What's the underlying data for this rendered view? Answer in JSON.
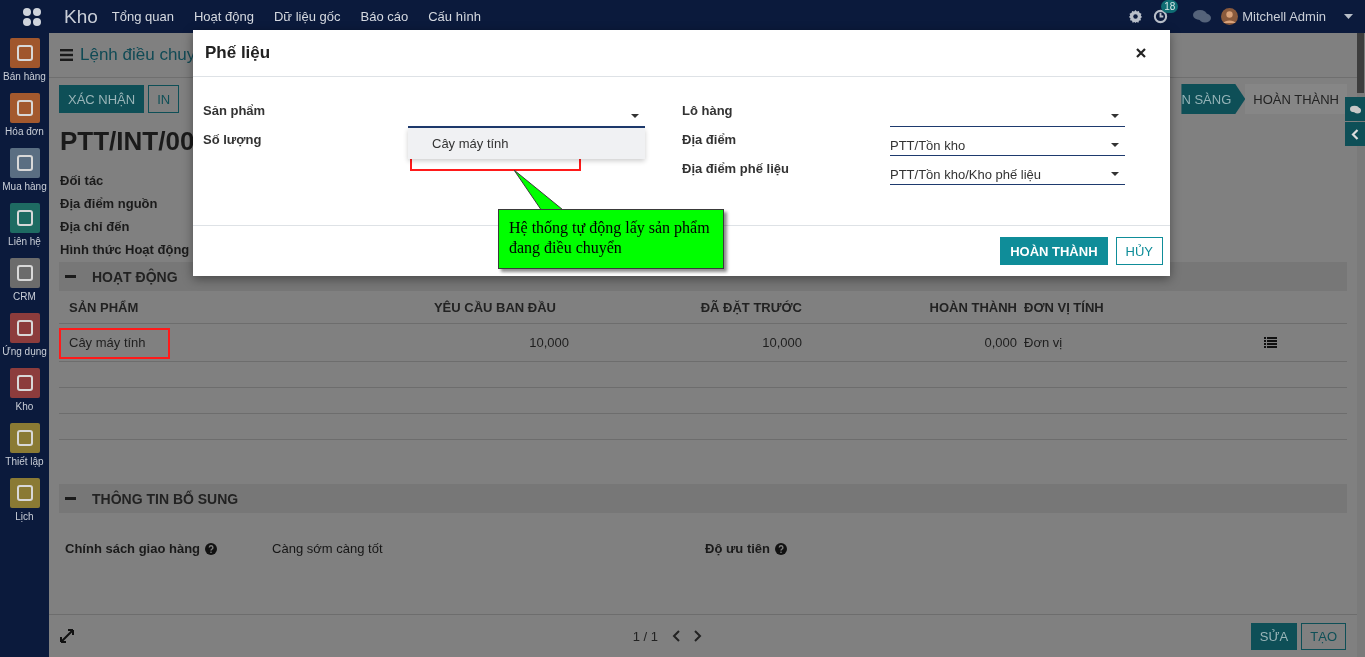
{
  "top_bar": {
    "app_name": "Kho",
    "menu": [
      "Tổng quan",
      "Hoạt động",
      "Dữ liệu gốc",
      "Báo cáo",
      "Cấu hình"
    ],
    "notification_count": "18",
    "user_name": "Mitchell Admin"
  },
  "sidebar": {
    "items": [
      {
        "label": "Bán hàng",
        "color": "#a0562c"
      },
      {
        "label": "Hóa đơn",
        "color": "#a3592e"
      },
      {
        "label": "Mua hàng",
        "color": "#5a6e82"
      },
      {
        "label": "Liên hệ",
        "color": "#1e6b62"
      },
      {
        "label": "CRM",
        "color": "#6b6b6b"
      },
      {
        "label": "Ứng dụng",
        "color": "#8c3c3c"
      },
      {
        "label": "Kho",
        "color": "#8c3c3c"
      },
      {
        "label": "Thiết lập",
        "color": "#8a7a34"
      },
      {
        "label": "Lịch",
        "color": "#8a7a34"
      }
    ]
  },
  "breadcrumb": "Lệnh điều chuy",
  "action_buttons": [
    {
      "label": "XÁC NHẬN",
      "kind": "primary"
    },
    {
      "label": "IN",
      "kind": "secondary"
    }
  ],
  "status_steps": [
    {
      "label": "N SÀNG",
      "selected": true
    },
    {
      "label": "HOÀN THÀNH",
      "selected": false
    }
  ],
  "record_title": "PTT/INT/00",
  "form_labels": [
    "Đối tác",
    "Địa điểm nguồn",
    "Địa chỉ đến",
    "Hình thức Hoạt động"
  ],
  "operations": {
    "title": "HOẠT ĐỘNG",
    "columns": [
      "SẢN PHẨM",
      "YÊU CẦU BAN ĐẦU",
      "ĐÃ ĐẶT TRƯỚC",
      "HOÀN THÀNH",
      "ĐƠN VỊ TÍNH"
    ],
    "rows": [
      {
        "cells": [
          "Cây máy tính",
          "10,000",
          "10,000",
          "0,000",
          "Đơn vị"
        ],
        "highlighted": true
      }
    ]
  },
  "extra_info": {
    "title": "THÔNG TIN BỔ SUNG",
    "fields": [
      {
        "label": "Chính sách giao hàng",
        "value": "Càng sớm càng tốt"
      },
      {
        "label": "Độ ưu tiên"
      }
    ]
  },
  "pager": "1 / 1",
  "bottom_buttons": [
    {
      "label": "SỬA",
      "kind": "primary"
    },
    {
      "label": "TẠO",
      "kind": "secondary"
    }
  ],
  "dialog": {
    "title": "Phế liệu",
    "left_fields": [
      {
        "label": "Sản phẩm",
        "kind": "select"
      },
      {
        "label": "Số lượng",
        "kind": "hidden"
      }
    ],
    "dropdown": {
      "options": [
        {
          "label": "Cây máy tính",
          "selected": true,
          "highlighted": true
        }
      ]
    },
    "right_fields": [
      {
        "label": "Lô hàng",
        "kind": "select"
      },
      {
        "label": "Địa điểm",
        "kind": "select",
        "value": "PTT/Tồn kho"
      },
      {
        "label": "Địa điểm phế liệu",
        "kind": "select",
        "value": "PTT/Tồn kho/Kho phế liệu"
      }
    ],
    "buttons": [
      {
        "label": "HOÀN THÀNH",
        "kind": "primary"
      },
      {
        "label": "HỦY",
        "kind": "secondary"
      }
    ]
  },
  "callout": {
    "text": "Hệ thống tự động lấy sản phẩm đang điều chuyển"
  }
}
